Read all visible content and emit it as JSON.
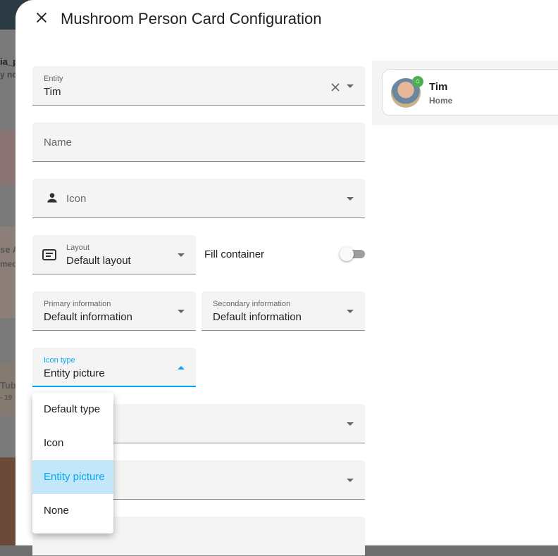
{
  "background": {
    "texts": [
      "ia_p",
      "y not",
      "se A",
      "med",
      "Tub",
      "- 19"
    ]
  },
  "dialog": {
    "title": "Mushroom Person Card Configuration"
  },
  "form": {
    "entity": {
      "label": "Entity",
      "value": "Tim"
    },
    "name": {
      "placeholder": "Name"
    },
    "icon": {
      "placeholder": "Icon"
    },
    "layout": {
      "label": "Layout",
      "value": "Default layout"
    },
    "fill_container": {
      "label": "Fill container",
      "checked": false
    },
    "primary": {
      "label": "Primary information",
      "value": "Default information"
    },
    "secondary": {
      "label": "Secondary information",
      "value": "Default information"
    },
    "icon_type": {
      "label": "Icon type",
      "value": "Entity picture",
      "options": [
        "Default type",
        "Icon",
        "Entity picture",
        "None"
      ]
    }
  },
  "preview": {
    "name": "Tim",
    "state": "Home"
  },
  "colors": {
    "accent": "#03a9f4",
    "badge": "#4caf50"
  }
}
